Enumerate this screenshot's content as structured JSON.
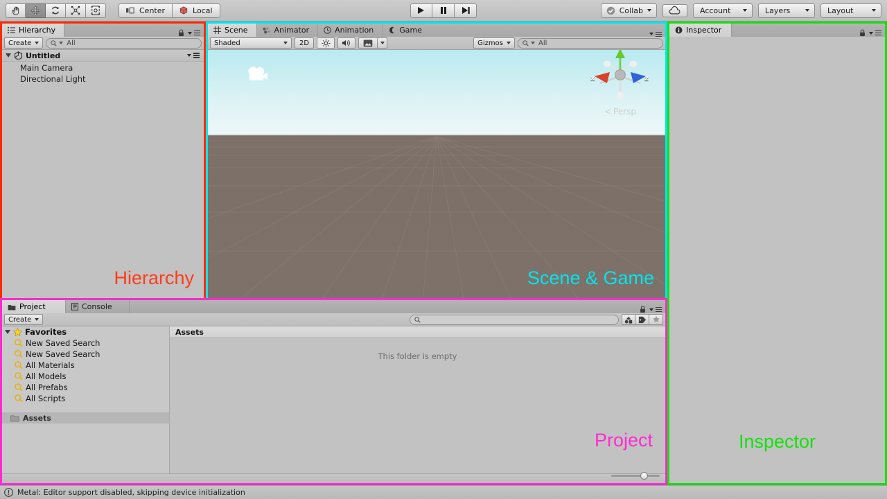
{
  "toolbar": {
    "tools": [
      {
        "name": "hand-tool",
        "glyph": "✋",
        "active": false
      },
      {
        "name": "move-tool",
        "glyph": "✥",
        "active": true
      },
      {
        "name": "rotate-tool",
        "glyph": "⟳",
        "active": false
      },
      {
        "name": "scale-tool",
        "glyph": "⤢",
        "active": false
      },
      {
        "name": "rect-tool",
        "glyph": "⬚",
        "active": false
      }
    ],
    "pivot_mode": "Center",
    "pivot_rotation": "Local",
    "transport": [
      {
        "name": "play-button",
        "glyph": "▶"
      },
      {
        "name": "pause-button",
        "glyph": "❚❚"
      },
      {
        "name": "step-button",
        "glyph": "▶❙"
      }
    ],
    "collab_label": "Collab",
    "cloud_label": "",
    "account_label": "Account",
    "layers_label": "Layers",
    "layout_label": "Layout"
  },
  "hierarchy": {
    "tab_label": "Hierarchy",
    "create_label": "Create",
    "search_placeholder": "All",
    "scene_name": "Untitled",
    "objects": [
      {
        "label": "Main Camera"
      },
      {
        "label": "Directional Light"
      }
    ],
    "annotation": "Hierarchy",
    "annotation_color": "#ff3c18",
    "border_color": "#ff2a00"
  },
  "sceneview": {
    "tabs": [
      {
        "label": "Scene",
        "icon": "grid-icon",
        "active": true
      },
      {
        "label": "Animator",
        "icon": "animator-icon",
        "active": false
      },
      {
        "label": "Animation",
        "icon": "clock-icon",
        "active": false
      },
      {
        "label": "Game",
        "icon": "gamepad-icon",
        "active": false
      }
    ],
    "draw_mode": "Shaded",
    "two_d_label": "2D",
    "lighting_icon": "sun-icon",
    "audio_icon": "speaker-icon",
    "fx_icon": "image-icon",
    "gizmos_label": "Gizmos",
    "search_placeholder": "All",
    "gizmo": {
      "x_label": "x",
      "z_label": "z",
      "perspective_label": "Persp",
      "x_color": "#d6442b",
      "y_color": "#63c02f",
      "z_color": "#2f63d6"
    },
    "camera_icon": "camera-gizmo-icon",
    "annotation": "Scene & Game",
    "annotation_color": "#00e5ee",
    "border_color": "#00e5ee"
  },
  "inspector": {
    "tab_label": "Inspector",
    "annotation": "Inspector",
    "annotation_color": "#15e00d",
    "border_color": "#15e00d"
  },
  "project": {
    "tabs": [
      {
        "label": "Project",
        "icon": "folder-icon",
        "active": true
      },
      {
        "label": "Console",
        "icon": "console-icon",
        "active": false
      }
    ],
    "create_label": "Create",
    "search_placeholder": "",
    "filter_icons": [
      {
        "name": "type-filter-icon"
      },
      {
        "name": "label-filter-icon"
      },
      {
        "name": "favorite-filter-icon"
      }
    ],
    "favorites_label": "Favorites",
    "favorites": [
      {
        "label": "New Saved Search"
      },
      {
        "label": "New Saved Search"
      },
      {
        "label": "All Materials"
      },
      {
        "label": "All Models"
      },
      {
        "label": "All Prefabs"
      },
      {
        "label": "All Scripts"
      }
    ],
    "assets_label": "Assets",
    "breadcrumb": "Assets",
    "empty_message": "This folder is empty",
    "annotation": "Project",
    "annotation_color": "#ff2ad1",
    "border_color": "#ff2ad1"
  },
  "status": {
    "icon": "warning-icon",
    "message": "Metal: Editor support disabled, skipping device initialization"
  }
}
